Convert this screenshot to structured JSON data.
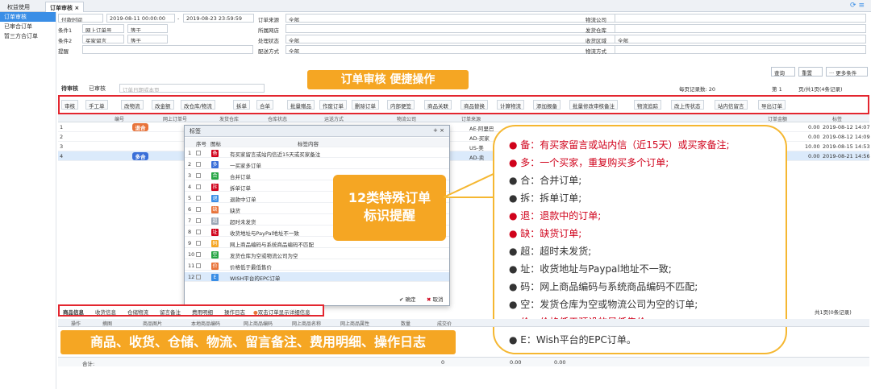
{
  "tabs": {
    "home": "权益使用",
    "active": "订单审核 ×"
  },
  "sidebar": {
    "items": [
      "订单审核",
      "已审合订单",
      "暂三方合订单"
    ]
  },
  "filters": {
    "time_label": "付款时间",
    "date_from": "2019-08-11 00:00:00",
    "date_to": "2019-08-23 23:59:59",
    "order_source_label": "订单来源",
    "order_source_value": "全部",
    "cond1_label": "条件1",
    "cond1_field": "网上订单号",
    "cond1_op": "等于",
    "cond2_label": "条件2",
    "cond2_field": "买家留言",
    "cond2_op": "等于",
    "shop_label": "所属网店",
    "shop_value": "",
    "status_label": "处理状态",
    "status_value": "全部",
    "delivery_label": "配送方式",
    "delivery_value": "全部",
    "reminder_label": "提醒",
    "logistics_label": "物流公司",
    "warehouse_label": "发货仓库",
    "collection_label": "收货区域",
    "collection_value": "全部",
    "track_label": "物流方式",
    "query": "查询",
    "reset": "重置",
    "more": "··· 更多条件"
  },
  "list_tabs": {
    "pending": "待审核",
    "reviewed": "已审核",
    "search_placeholder": "订单日期或本页",
    "page_info": "每页记录数: 20",
    "page_of": "第 1",
    "total": "页/共1页(4条记录)"
  },
  "banner_top": "订单审核 便捷操作",
  "toolbar": [
    "审核",
    "手工单",
    "改物流",
    "改金额",
    "改仓库/物流",
    "拆单",
    "合单",
    "批量赠品",
    "作废订单",
    "删除订单",
    "内部便签",
    "商品关联",
    "商品替换",
    "计算物流",
    "添加报备",
    "批量修改审核备注",
    "物流追踪",
    "改上传状态",
    "站内信留言",
    "导出订单"
  ],
  "table_headers": [
    "编号",
    "网上订单号",
    "发货仓库",
    "仓库状态",
    "运送方式",
    "物流公司",
    "订单来源",
    "订单金额",
    "标签"
  ],
  "rows": [
    {
      "no": "1",
      "tag": "退合",
      "source": "AE-阿里巴",
      "amt": "0.00",
      "date": "2019-08-12 14:07"
    },
    {
      "no": "2",
      "tag": "",
      "source": "AD-买家",
      "amt": "0.00",
      "date": "2019-08-12 14:09"
    },
    {
      "no": "3",
      "tag": "",
      "source": "US-美",
      "amt": "10.00",
      "date": "2019-08-15 14:53"
    },
    {
      "no": "4",
      "tag": "多合",
      "source": "AD-卖",
      "amt": "0.00",
      "date": "2019-08-21 14:56"
    }
  ],
  "dialog": {
    "title": "标签",
    "header_no": "序号",
    "header_icon": "图标",
    "header_content": "标签内容",
    "items": [
      {
        "icon": "备",
        "color": "#d0021b",
        "text": "有买家留言或站内信近15天或买家备注"
      },
      {
        "icon": "多",
        "color": "#3a6fd8",
        "text": "一买家多订单"
      },
      {
        "icon": "合",
        "color": "#27a645",
        "text": "合并订单"
      },
      {
        "icon": "拆",
        "color": "#d0021b",
        "text": "拆单订单"
      },
      {
        "icon": "退",
        "color": "#3a8ee6",
        "text": "退款中订单"
      },
      {
        "icon": "缺",
        "color": "#e8743b",
        "text": "缺货"
      },
      {
        "icon": "超",
        "color": "#9aa6b5",
        "text": "超时未发货"
      },
      {
        "icon": "址",
        "color": "#d0021b",
        "text": "收货地址与PayPal地址不一致"
      },
      {
        "icon": "码",
        "color": "#f5a623",
        "text": "网上商品编码与系统商品编码不匹配"
      },
      {
        "icon": "空",
        "color": "#27a645",
        "text": "发货仓库为空或物流公司为空"
      },
      {
        "icon": "价",
        "color": "#e8743b",
        "text": "价格低于最低售价"
      },
      {
        "icon": "E",
        "color": "#3a8ee6",
        "text": "WISH平台的EPC订单"
      }
    ],
    "ok": "确定",
    "cancel": "取消"
  },
  "callout_mid": "12类特殊订单\n标识提醒",
  "bubble_lines": [
    {
      "text": "● 备：有买家留言或站内信（近15天）或买家备注;",
      "red": true
    },
    {
      "text": "● 多：一个买家，重复购买多个订单;",
      "red": true
    },
    {
      "text": "● 合：合并订单;",
      "red": false
    },
    {
      "text": "● 拆：拆单订单;",
      "red": false
    },
    {
      "text": "● 退：退款中的订单;",
      "red": true
    },
    {
      "text": "● 缺：缺货订单;",
      "red": true
    },
    {
      "text": "● 超：超时未发货;",
      "red": false
    },
    {
      "text": "● 址：收货地址与Paypal地址不一致;",
      "red": false
    },
    {
      "text": "● 码：网上商品编码与系统商品编码不匹配;",
      "red": false
    },
    {
      "text": "● 空：发货仓库为空或物流公司为空的订单;",
      "red": false
    },
    {
      "text": "● 价：价格低于预设的最低售价;",
      "red": true
    },
    {
      "text": "● E：Wish平台的EPC订单。",
      "red": false
    }
  ],
  "bottom_tabs": [
    "商品信息",
    "收货信息",
    "仓储物流",
    "留言备注",
    "费用明细",
    "操作日志",
    "双击订单显示详细信息"
  ],
  "bottom_headers": [
    "操作",
    "摘图",
    "商品图片",
    "本地商品编码",
    "网上商品编码",
    "网上商品名称",
    "网上商品属性",
    "数量",
    "成交价"
  ],
  "bottom_banner": "商品、收货、仓储、物流、留言备注、费用明细、操作日志",
  "footer": {
    "total_label": "合计:",
    "qty": "0",
    "amt1": "0.00",
    "amt2": "0.00"
  },
  "pager_bottom": "共1页(0条记录)"
}
